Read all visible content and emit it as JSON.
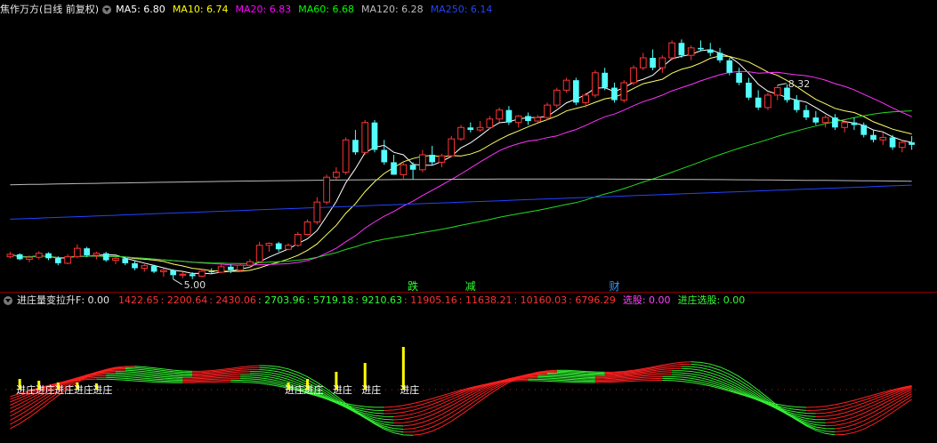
{
  "main_header": {
    "stock": "焦作万方",
    "period": "(日线 前复权)",
    "mas": [
      {
        "label": "MA5: 6.80",
        "color": "#ffffff"
      },
      {
        "label": "MA10: 6.74",
        "color": "#ffff00"
      },
      {
        "label": "MA20: 6.83",
        "color": "#ff00ff"
      },
      {
        "label": "MA60: 6.68",
        "color": "#00ff00"
      },
      {
        "label": "MA120: 6.28",
        "color": "#bbbbbb"
      },
      {
        "label": "MA250: 6.14",
        "color": "#2244ff"
      }
    ]
  },
  "sub_header": {
    "name": "进庄量变拉升F",
    "first_value": ": 0.00",
    "values": [
      {
        "label": "1422.65",
        "color": "#ff3333"
      },
      {
        "label": ": 2200.64",
        "color": "#ff3333"
      },
      {
        "label": ": 2430.06",
        "color": "#ff3333"
      },
      {
        "label": ": 2703.96",
        "color": "#33ff33"
      },
      {
        "label": ": 5719.18",
        "color": "#33ff33"
      },
      {
        "label": ": 9210.63",
        "color": "#33ff33"
      },
      {
        "label": ": 11905.16",
        "color": "#ff3333"
      },
      {
        "label": ": 11638.21",
        "color": "#ff3333"
      },
      {
        "label": ": 10160.03",
        "color": "#ff3333"
      },
      {
        "label": ": 6796.29",
        "color": "#ff3333"
      },
      {
        "label": "选股: 0.00",
        "color": "#ff44ff"
      },
      {
        "label": "进庄选股: 0.00",
        "color": "#33ff33"
      }
    ]
  },
  "markers": [
    {
      "text": "跌",
      "color": "#33ff33",
      "x_index": 42
    },
    {
      "text": "减",
      "color": "#33ff33",
      "x_index": 48
    },
    {
      "text": "财",
      "color": "#3399ff",
      "x_index": 63
    }
  ],
  "bottom_labels": [
    {
      "text": "进庄",
      "x_index": 1
    },
    {
      "text": "进庄",
      "x_index": 3
    },
    {
      "text": "进庄",
      "x_index": 5
    },
    {
      "text": "进庄",
      "x_index": 7
    },
    {
      "text": "进庄",
      "x_index": 9
    },
    {
      "text": "进庄",
      "x_index": 29
    },
    {
      "text": "进庄",
      "x_index": 31
    },
    {
      "text": "进庄",
      "x_index": 34
    },
    {
      "text": "进庄",
      "x_index": 37
    },
    {
      "text": "进庄",
      "x_index": 41
    },
    {
      "text": "进庄",
      "x_index": 107
    }
  ],
  "colors": {
    "up": "#ff3333",
    "down": "#54fcfc",
    "separator": "#8b0000",
    "osc_red": "#ff2020",
    "osc_green": "#33ee33",
    "vol_bar": "#ffff00"
  },
  "chart_data": [
    {
      "type": "candlestick",
      "title": "焦作万方 (日线 前复权)",
      "ylim": [
        4.7,
        8.6
      ],
      "annotations": [
        {
          "text": "8.32",
          "x_index": 80,
          "y": 8.32
        },
        {
          "text": "5.00",
          "x_index": 17,
          "y": 5.0
        }
      ],
      "ohlc": [
        [
          5.45,
          5.55,
          5.42,
          5.5
        ],
        [
          5.5,
          5.52,
          5.38,
          5.4
        ],
        [
          5.4,
          5.48,
          5.34,
          5.44
        ],
        [
          5.44,
          5.56,
          5.4,
          5.52
        ],
        [
          5.52,
          5.54,
          5.38,
          5.42
        ],
        [
          5.42,
          5.46,
          5.28,
          5.32
        ],
        [
          5.32,
          5.5,
          5.3,
          5.45
        ],
        [
          5.45,
          5.7,
          5.42,
          5.62
        ],
        [
          5.62,
          5.65,
          5.45,
          5.48
        ],
        [
          5.48,
          5.55,
          5.4,
          5.52
        ],
        [
          5.52,
          5.55,
          5.35,
          5.38
        ],
        [
          5.38,
          5.45,
          5.3,
          5.42
        ],
        [
          5.42,
          5.44,
          5.28,
          5.32
        ],
        [
          5.32,
          5.38,
          5.18,
          5.22
        ],
        [
          5.22,
          5.3,
          5.15,
          5.27
        ],
        [
          5.27,
          5.29,
          5.12,
          5.15
        ],
        [
          5.15,
          5.22,
          5.05,
          5.18
        ],
        [
          5.18,
          5.2,
          5.0,
          5.08
        ],
        [
          5.08,
          5.15,
          5.02,
          5.1
        ],
        [
          5.1,
          5.14,
          5.0,
          5.06
        ],
        [
          5.06,
          5.2,
          5.04,
          5.16
        ],
        [
          5.16,
          5.22,
          5.1,
          5.14
        ],
        [
          5.14,
          5.3,
          5.12,
          5.25
        ],
        [
          5.25,
          5.3,
          5.12,
          5.18
        ],
        [
          5.18,
          5.32,
          5.15,
          5.28
        ],
        [
          5.28,
          5.4,
          5.22,
          5.35
        ],
        [
          5.35,
          5.75,
          5.33,
          5.68
        ],
        [
          5.68,
          5.74,
          5.55,
          5.72
        ],
        [
          5.72,
          5.75,
          5.55,
          5.6
        ],
        [
          5.6,
          5.72,
          5.58,
          5.68
        ],
        [
          5.68,
          5.95,
          5.65,
          5.9
        ],
        [
          5.9,
          6.2,
          5.88,
          6.15
        ],
        [
          6.15,
          6.65,
          6.1,
          6.55
        ],
        [
          6.55,
          7.1,
          6.5,
          7.05
        ],
        [
          7.05,
          7.25,
          7.0,
          7.15
        ],
        [
          7.15,
          7.85,
          7.1,
          7.8
        ],
        [
          7.8,
          8.0,
          7.5,
          7.55
        ],
        [
          7.55,
          8.2,
          7.5,
          8.15
        ],
        [
          8.15,
          8.2,
          7.55,
          7.6
        ],
        [
          7.6,
          7.8,
          7.3,
          7.35
        ],
        [
          7.35,
          7.5,
          7.1,
          7.1
        ],
        [
          7.1,
          7.38,
          7.0,
          7.3
        ],
        [
          7.3,
          7.35,
          7.0,
          7.2
        ],
        [
          7.2,
          7.6,
          7.15,
          7.5
        ],
        [
          7.5,
          7.68,
          7.3,
          7.35
        ],
        [
          7.35,
          7.52,
          7.25,
          7.48
        ],
        [
          7.48,
          7.88,
          7.45,
          7.82
        ],
        [
          7.82,
          8.1,
          7.78,
          8.05
        ],
        [
          8.05,
          8.15,
          7.95,
          8.0
        ],
        [
          8.0,
          8.18,
          7.96,
          8.05
        ],
        [
          8.05,
          8.28,
          8.02,
          8.22
        ],
        [
          8.22,
          8.45,
          8.15,
          8.4
        ],
        [
          8.4,
          8.48,
          8.1,
          8.15
        ],
        [
          8.15,
          8.3,
          8.05,
          8.28
        ],
        [
          8.28,
          8.35,
          8.1,
          8.18
        ],
        [
          8.18,
          8.3,
          8.15,
          8.25
        ],
        [
          8.25,
          8.55,
          8.2,
          8.5
        ],
        [
          8.5,
          8.85,
          8.45,
          8.8
        ],
        [
          8.8,
          9.05,
          8.75,
          9.0
        ],
        [
          9.0,
          9.05,
          8.5,
          8.55
        ],
        [
          8.55,
          8.75,
          8.45,
          8.7
        ],
        [
          8.7,
          9.2,
          8.65,
          9.15
        ],
        [
          9.15,
          9.25,
          8.8,
          8.85
        ],
        [
          8.85,
          8.95,
          8.55,
          8.6
        ],
        [
          8.6,
          9.0,
          8.55,
          8.95
        ],
        [
          8.95,
          9.3,
          8.9,
          9.25
        ],
        [
          9.25,
          9.55,
          9.2,
          9.45
        ],
        [
          9.45,
          9.62,
          9.2,
          9.25
        ],
        [
          9.25,
          9.5,
          9.15,
          9.45
        ],
        [
          9.45,
          9.8,
          9.4,
          9.75
        ],
        [
          9.75,
          9.82,
          9.45,
          9.5
        ],
        [
          9.5,
          9.7,
          9.4,
          9.65
        ],
        [
          9.65,
          9.8,
          9.6,
          9.62
        ],
        [
          9.62,
          9.75,
          9.48,
          9.55
        ],
        [
          9.55,
          9.65,
          9.35,
          9.4
        ],
        [
          9.4,
          9.45,
          9.1,
          9.15
        ],
        [
          9.15,
          9.25,
          8.9,
          8.95
        ],
        [
          8.95,
          9.05,
          8.6,
          8.65
        ],
        [
          8.65,
          8.8,
          8.4,
          8.45
        ],
        [
          8.45,
          8.75,
          8.4,
          8.7
        ],
        [
          8.7,
          8.9,
          8.6,
          8.85
        ],
        [
          8.85,
          8.92,
          8.55,
          8.6
        ],
        [
          8.6,
          8.7,
          8.35,
          8.4
        ],
        [
          8.4,
          8.5,
          8.2,
          8.25
        ],
        [
          8.25,
          8.38,
          8.1,
          8.15
        ],
        [
          8.15,
          8.3,
          8.05,
          8.25
        ],
        [
          8.25,
          8.32,
          8.0,
          8.05
        ],
        [
          8.05,
          8.2,
          7.95,
          8.15
        ],
        [
          8.15,
          8.25,
          8.0,
          8.1
        ],
        [
          8.1,
          8.15,
          7.85,
          7.9
        ],
        [
          7.9,
          8.0,
          7.75,
          7.8
        ],
        [
          7.8,
          7.95,
          7.7,
          7.85
        ],
        [
          7.85,
          7.9,
          7.6,
          7.65
        ],
        [
          7.65,
          7.8,
          7.55,
          7.75
        ],
        [
          7.75,
          7.88,
          7.6,
          7.7
        ]
      ]
    },
    {
      "type": "line",
      "title": "进庄量变拉升F",
      "ylim": [
        0,
        12000
      ],
      "series": [
        {
          "name": "1422.65",
          "values": [
            1422.65
          ]
        },
        {
          "name": "2200.64",
          "values": [
            2200.64
          ]
        },
        {
          "name": "2430.06",
          "values": [
            2430.06
          ]
        },
        {
          "name": "2703.96",
          "values": [
            2703.96
          ]
        },
        {
          "name": "5719.18",
          "values": [
            5719.18
          ]
        },
        {
          "name": "9210.63",
          "values": [
            9210.63
          ]
        },
        {
          "name": "11905.16",
          "values": [
            11905.16
          ]
        },
        {
          "name": "11638.21",
          "values": [
            11638.21
          ]
        },
        {
          "name": "10160.03",
          "values": [
            10160.03
          ]
        },
        {
          "name": "6796.29",
          "values": [
            6796.29
          ]
        }
      ]
    }
  ]
}
